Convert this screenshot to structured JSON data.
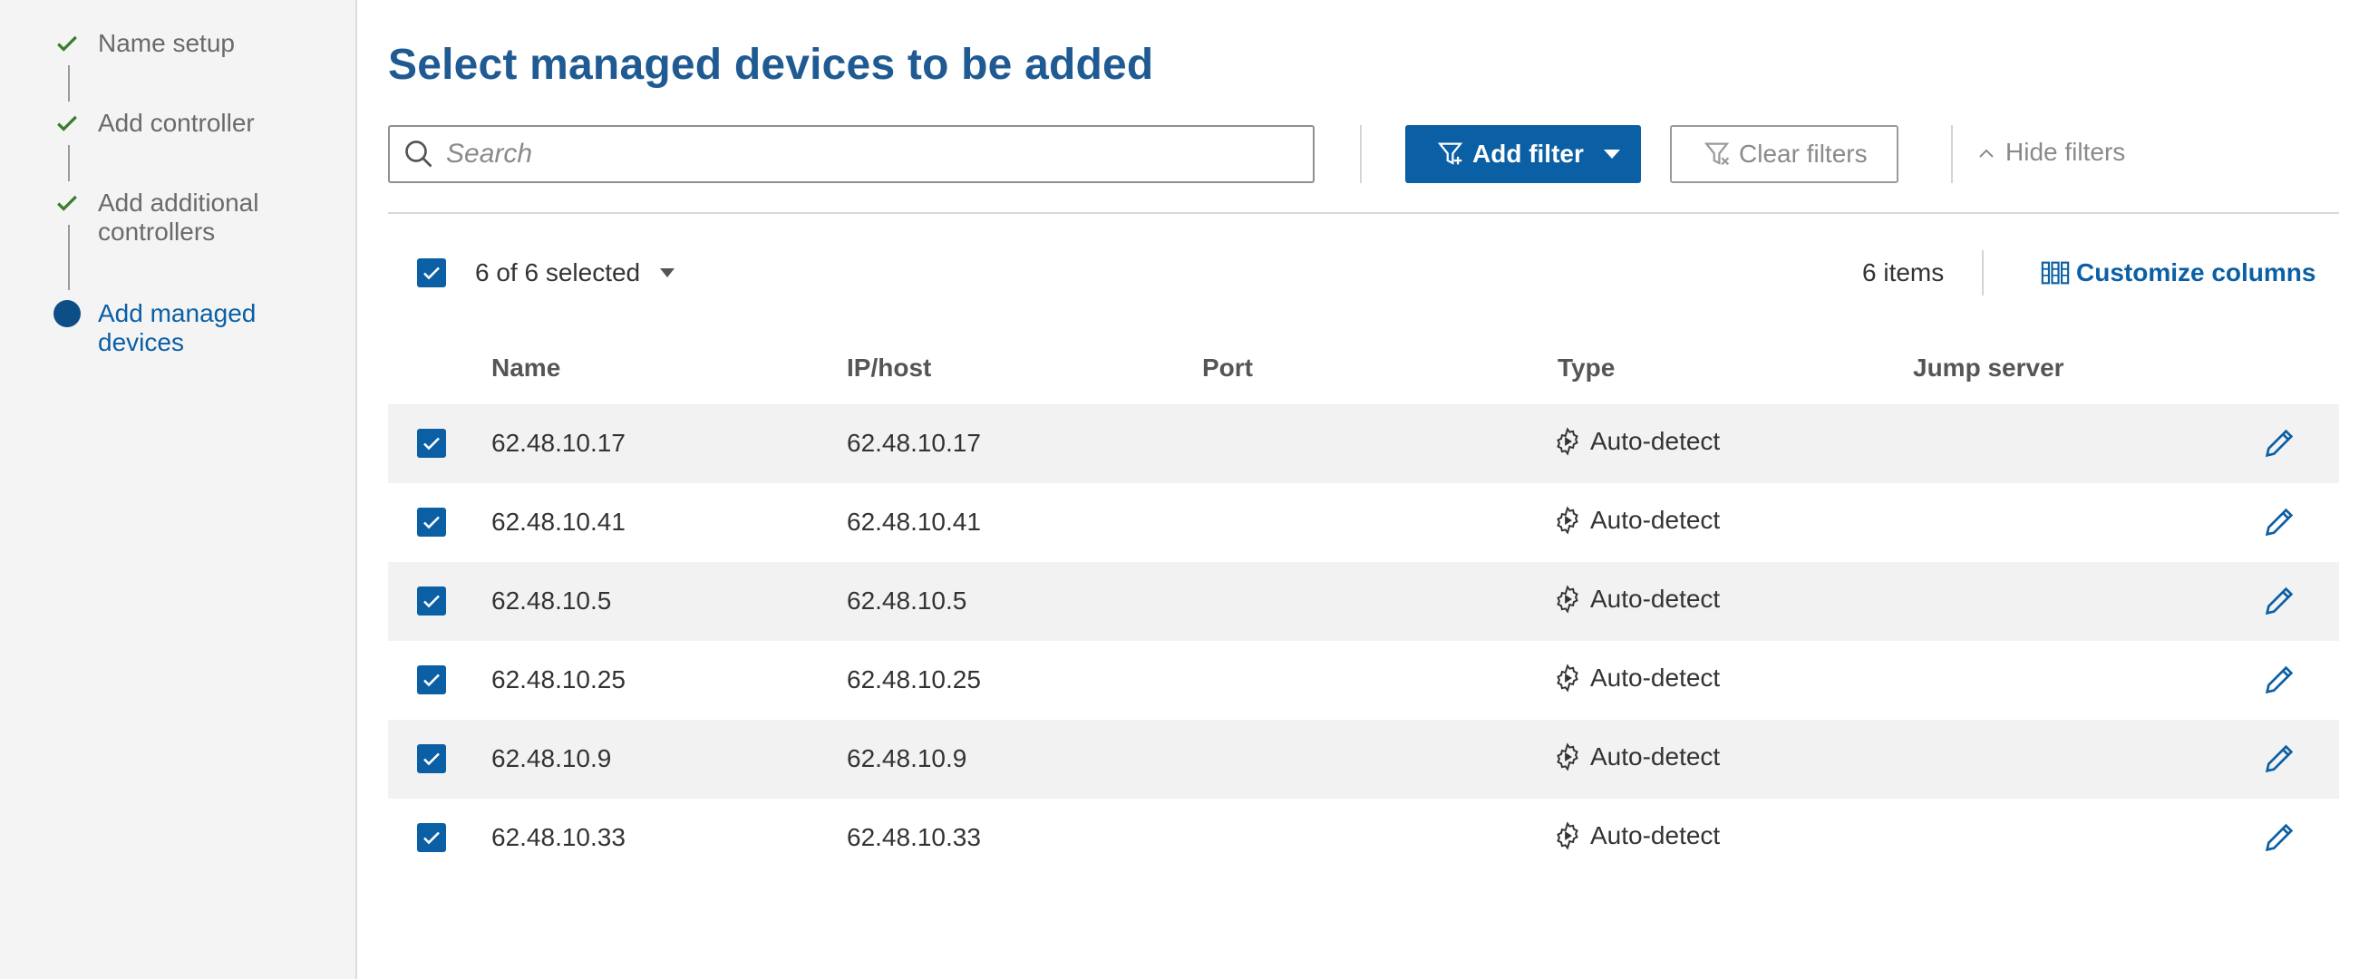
{
  "wizard": {
    "steps": [
      {
        "label_lines": [
          "Name setup"
        ],
        "state": "done"
      },
      {
        "label_lines": [
          "Add controller"
        ],
        "state": "done"
      },
      {
        "label_lines": [
          "Add additional",
          "controllers"
        ],
        "state": "done"
      },
      {
        "label_lines": [
          "Add managed",
          "devices"
        ],
        "state": "active"
      }
    ]
  },
  "page": {
    "title": "Select managed devices to be added"
  },
  "toolbar": {
    "search_placeholder": "Search",
    "add_filter_label": "Add filter",
    "clear_filters_label": "Clear filters",
    "hide_filters_label": "Hide filters"
  },
  "selection": {
    "summary": "6 of 6 selected",
    "items_count": "6 items",
    "customize_columns_label": "Customize columns"
  },
  "table": {
    "columns": [
      "Name",
      "IP/host",
      "Port",
      "Type",
      "Jump server"
    ],
    "rows": [
      {
        "name": "62.48.10.17",
        "ip": "62.48.10.17",
        "port": "",
        "type": "Auto-detect",
        "jump": "",
        "checked": true
      },
      {
        "name": "62.48.10.41",
        "ip": "62.48.10.41",
        "port": "",
        "type": "Auto-detect",
        "jump": "",
        "checked": true
      },
      {
        "name": "62.48.10.5",
        "ip": "62.48.10.5",
        "port": "",
        "type": "Auto-detect",
        "jump": "",
        "checked": true
      },
      {
        "name": "62.48.10.25",
        "ip": "62.48.10.25",
        "port": "",
        "type": "Auto-detect",
        "jump": "",
        "checked": true
      },
      {
        "name": "62.48.10.9",
        "ip": "62.48.10.9",
        "port": "",
        "type": "Auto-detect",
        "jump": "",
        "checked": true
      },
      {
        "name": "62.48.10.33",
        "ip": "62.48.10.33",
        "port": "",
        "type": "Auto-detect",
        "jump": "",
        "checked": true
      }
    ]
  },
  "colors": {
    "accent": "#0b5fa5",
    "title": "#1f5a92",
    "check_done": "#3a7d2a",
    "active_dot": "#0e4e86",
    "row_shade": "#f2f2f2"
  },
  "icons": {
    "step_done": "checkmark-icon",
    "search": "search-icon",
    "add_filter": "filter-add-icon",
    "clear_filters": "filter-clear-icon",
    "hide_filters": "chevron-up-icon",
    "customize_columns": "columns-icon",
    "type": "gear-play-icon",
    "edit": "pencil-icon"
  }
}
